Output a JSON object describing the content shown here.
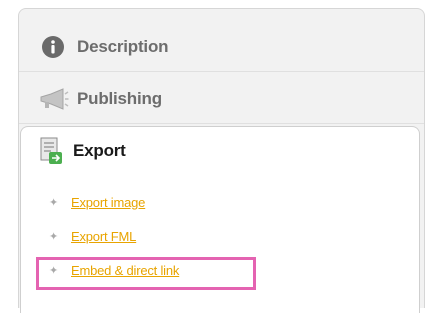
{
  "sidebar": {
    "tabs": [
      {
        "label": "Description",
        "icon": "info-icon",
        "selected": false
      },
      {
        "label": "Publishing",
        "icon": "megaphone-icon",
        "selected": false
      },
      {
        "label": "Export",
        "icon": "export-icon",
        "selected": true
      }
    ]
  },
  "export": {
    "links": [
      {
        "label": "Export image"
      },
      {
        "label": "Export FML"
      },
      {
        "label": "Embed & direct link"
      }
    ]
  },
  "colors": {
    "link": "#e8a400",
    "highlight": "#e463b1",
    "panel_bg": "#f2f2f2",
    "active_tab_bg": "#ffffff"
  }
}
